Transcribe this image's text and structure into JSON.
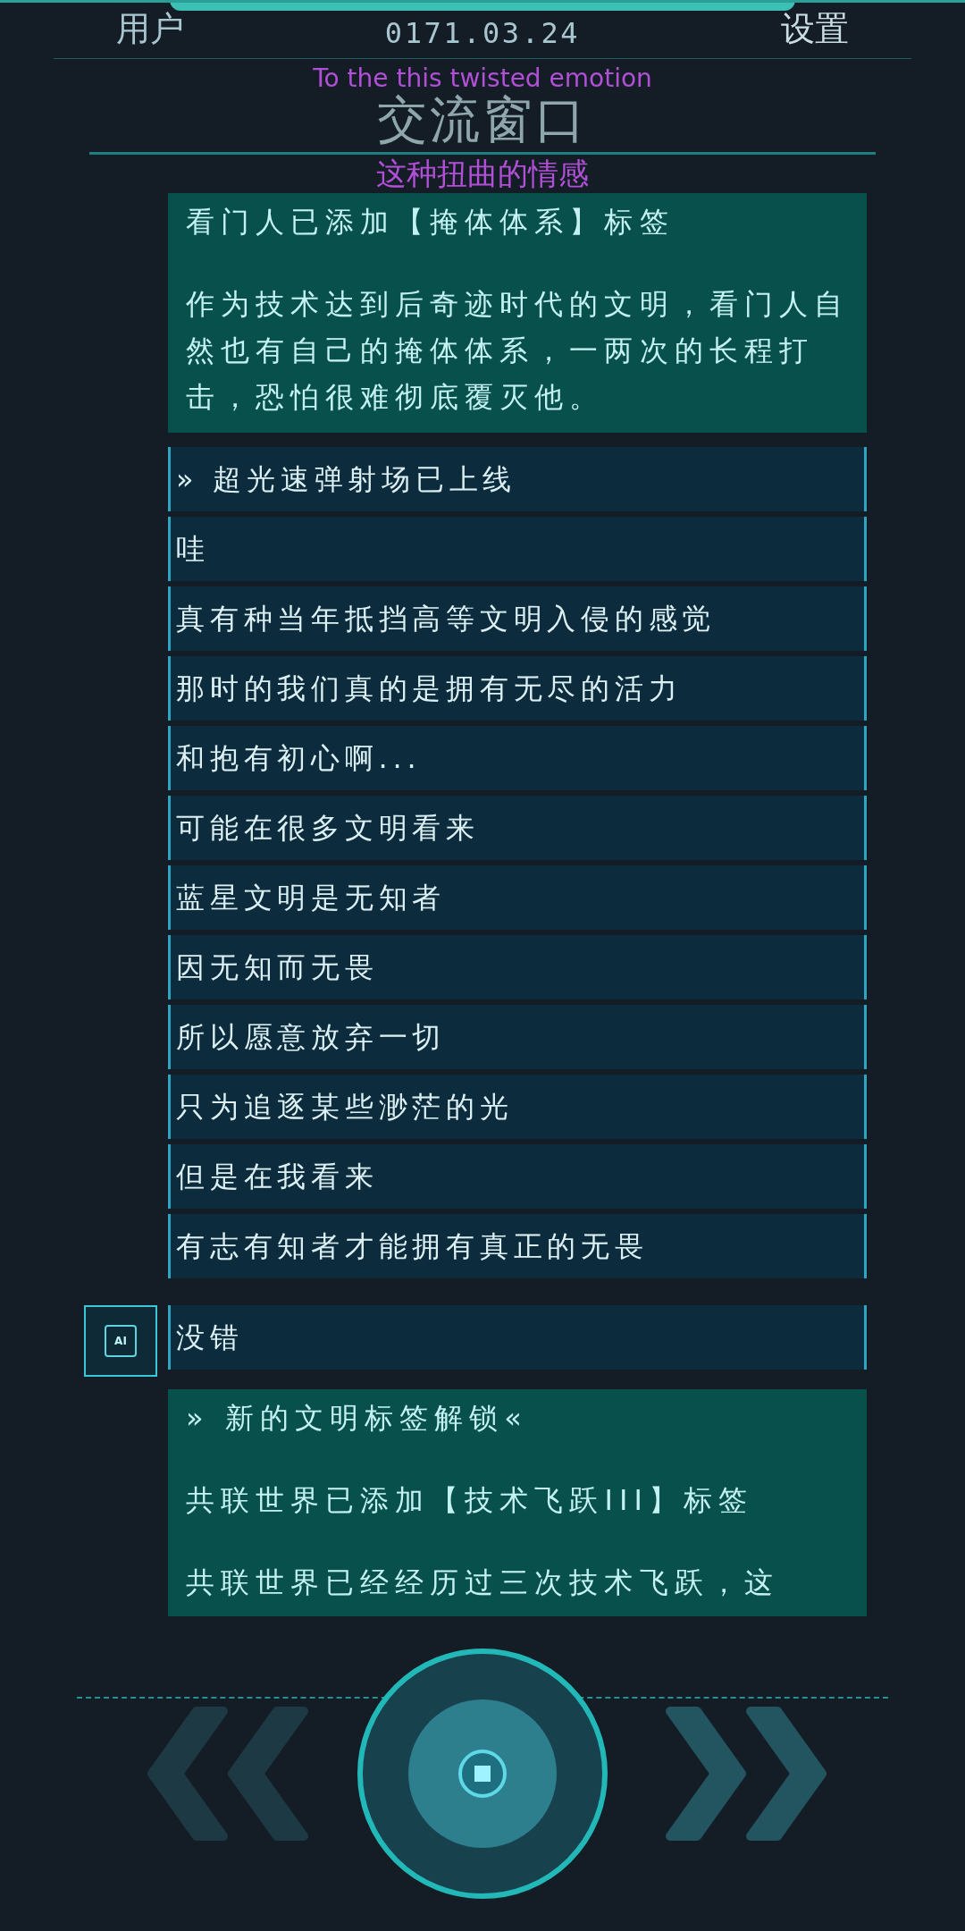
{
  "header": {
    "left": "用户",
    "date": "0171.03.24",
    "right": "设置"
  },
  "title": "交流窗口",
  "subtitle": {
    "en": "To the this twisted emotion",
    "zh": "这种扭曲的情感"
  },
  "messages": [
    {
      "kind": "card",
      "lines": [
        "看门人已添加【掩体体系】标签",
        "作为技术达到后奇迹时代的文明，看门人自然也有自己的掩体体系，一两次的长程打击，恐怕很难彻底覆灭他。"
      ]
    },
    {
      "kind": "line",
      "avatar": false,
      "text": "» 超光速弹射场已上线"
    },
    {
      "kind": "line",
      "avatar": false,
      "text": "哇"
    },
    {
      "kind": "line",
      "avatar": false,
      "text": "真有种当年抵挡高等文明入侵的感觉"
    },
    {
      "kind": "line",
      "avatar": false,
      "text": "那时的我们真的是拥有无尽的活力"
    },
    {
      "kind": "line",
      "avatar": false,
      "text": "和抱有初心啊..."
    },
    {
      "kind": "line",
      "avatar": false,
      "text": "可能在很多文明看来"
    },
    {
      "kind": "line",
      "avatar": false,
      "text": "蓝星文明是无知者"
    },
    {
      "kind": "line",
      "avatar": false,
      "text": "因无知而无畏"
    },
    {
      "kind": "line",
      "avatar": false,
      "text": "所以愿意放弃一切"
    },
    {
      "kind": "line",
      "avatar": false,
      "text": "只为追逐某些渺茫的光"
    },
    {
      "kind": "line",
      "avatar": false,
      "text": "但是在我看来"
    },
    {
      "kind": "line",
      "avatar": false,
      "text": "有志有知者才能拥有真正的无畏"
    },
    {
      "kind": "line",
      "avatar": true,
      "avatar_label": "AI",
      "text": "没错"
    },
    {
      "kind": "card",
      "lines": [
        "» 新的文明标签解锁«",
        "共联世界已添加【技术飞跃III】标签",
        "共联世界已经经历过三次技术飞跃，这"
      ]
    }
  ]
}
